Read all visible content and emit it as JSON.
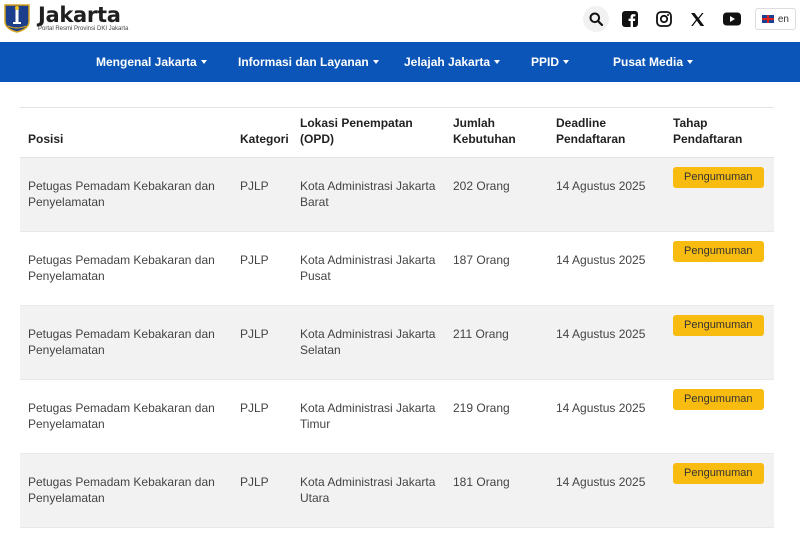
{
  "header": {
    "brand_name": "Jakarta",
    "brand_subtitle": "Portal Resmi Provinsi DKI Jakarta",
    "language": "en"
  },
  "nav": {
    "items": [
      {
        "label": "Mengenal Jakarta"
      },
      {
        "label": "Informasi dan Layanan"
      },
      {
        "label": "Jelajah Jakarta"
      },
      {
        "label": "PPID"
      },
      {
        "label": "Pusat Media"
      }
    ]
  },
  "table": {
    "headers": {
      "posisi": "Posisi",
      "kategori": "Kategori",
      "lokasi": "Lokasi Penempatan (OPD)",
      "jumlah": "Jumlah Kebutuhan",
      "deadline": "Deadline Pendaftaran",
      "tahap": "Tahap Pendaftaran"
    },
    "rows": [
      {
        "posisi": "Petugas Pemadam Kebakaran dan Penyelamatan",
        "kategori": "PJLP",
        "lokasi": "Kota Administrasi Jakarta Barat",
        "jumlah": "202 Orang",
        "deadline": "14 Agustus 2025",
        "tahap": "Pengumuman"
      },
      {
        "posisi": "Petugas Pemadam Kebakaran dan Penyelamatan",
        "kategori": "PJLP",
        "lokasi": "Kota Administrasi Jakarta Pusat",
        "jumlah": "187 Orang",
        "deadline": "14 Agustus 2025",
        "tahap": "Pengumuman"
      },
      {
        "posisi": "Petugas Pemadam Kebakaran dan Penyelamatan",
        "kategori": "PJLP",
        "lokasi": "Kota Administrasi Jakarta Selatan",
        "jumlah": "211 Orang",
        "deadline": "14 Agustus 2025",
        "tahap": "Pengumuman"
      },
      {
        "posisi": "Petugas Pemadam Kebakaran dan Penyelamatan",
        "kategori": "PJLP",
        "lokasi": "Kota Administrasi Jakarta Timur",
        "jumlah": "219 Orang",
        "deadline": "14 Agustus 2025",
        "tahap": "Pengumuman"
      },
      {
        "posisi": "Petugas Pemadam Kebakaran dan Penyelamatan",
        "kategori": "PJLP",
        "lokasi": "Kota Administrasi Jakarta Utara",
        "jumlah": "181 Orang",
        "deadline": "14 Agustus 2025",
        "tahap": "Pengumuman"
      }
    ]
  },
  "colors": {
    "nav_blue": "#0a55b7",
    "button_yellow": "#f8bb0f",
    "row_stripe": "#f2f2f2"
  },
  "icons": [
    "jakarta-crest-icon",
    "search-icon",
    "facebook-icon",
    "instagram-icon",
    "x-icon",
    "youtube-icon",
    "uk-flag-icon"
  ]
}
